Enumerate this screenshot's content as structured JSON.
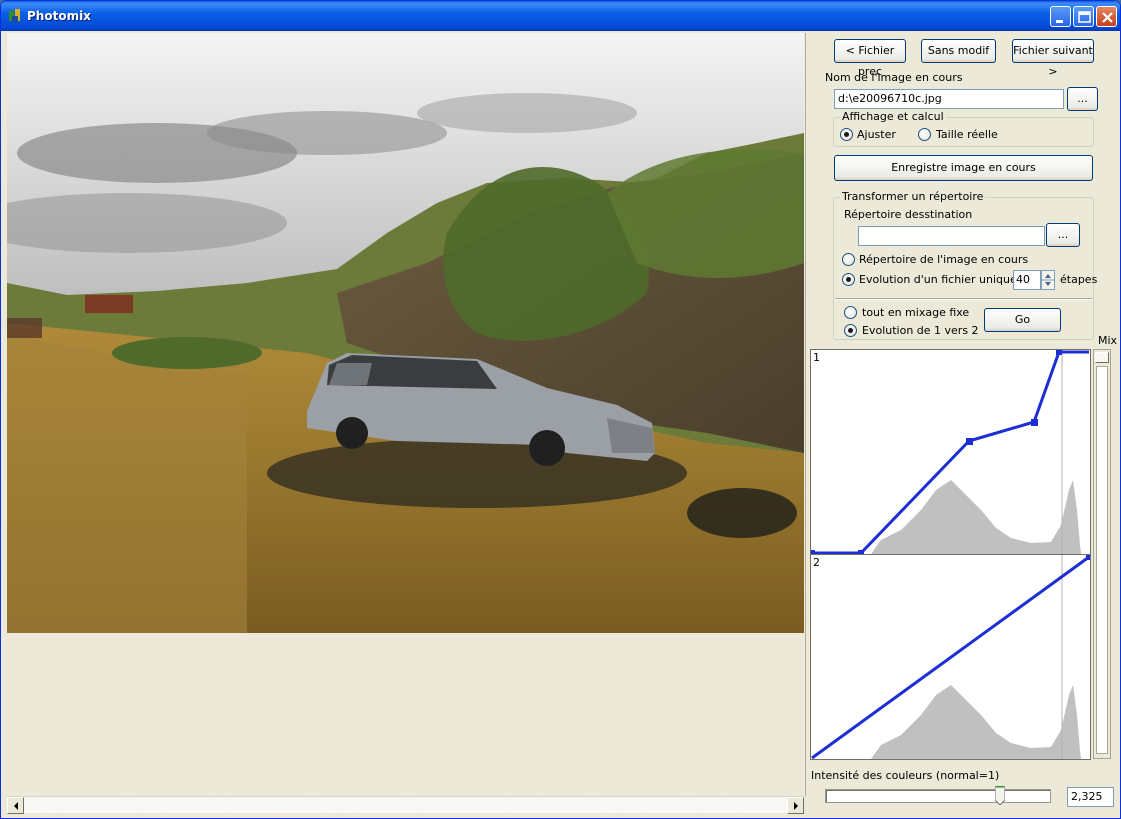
{
  "window": {
    "title": "Photomix"
  },
  "nav": {
    "prev_label": "< Fichier prec",
    "nomod_label": "Sans modif",
    "next_label": "Fichier suivant >"
  },
  "current_image": {
    "label": "Nom de l'image en cours",
    "value": "d:\\e20096710c.jpg",
    "browse_label": "..."
  },
  "display": {
    "group_title": "Affichage et calcul",
    "fit_label": "Ajuster",
    "real_size_label": "Taille réelle",
    "selected": "fit"
  },
  "save_button": "Enregistre  image en cours",
  "transform": {
    "group_title": "Transformer un  répertoire",
    "dest_label": "Répertoire desstination",
    "dest_value": "",
    "browse_label": "...",
    "opt_same_dir": "Répertoire de l'image en cours",
    "opt_evolution": "Evolution d'un fichier unique en",
    "steps_value": "40",
    "steps_suffix": "étapes",
    "opt_fixed_mix": "tout en mixage fixe",
    "opt_1_to_2": "Evolution de 1 vers 2",
    "go_label": "Go",
    "selected_dir_mode": "evolution",
    "selected_mix_mode": "1_to_2"
  },
  "mix_label": "Mix",
  "curves": {
    "curve1_label": "1",
    "curve2_label": "2"
  },
  "intensity": {
    "label": "Intensité des couleurs  (normal=1)",
    "value": "2,325",
    "slider_fraction": 0.775
  },
  "colors": {
    "curve": "#1c2ed4",
    "histogram": "#c0c0c0",
    "title_bar": "#0a5fe8"
  }
}
